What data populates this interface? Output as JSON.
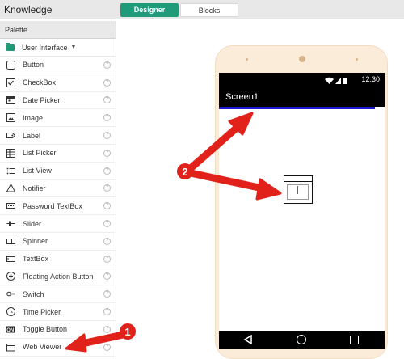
{
  "app": {
    "title": "Knowledge"
  },
  "tabs": [
    {
      "label": "Designer",
      "active": true
    },
    {
      "label": "Blocks",
      "active": false
    }
  ],
  "palette": {
    "header": "Palette",
    "category": "User Interface",
    "items": [
      {
        "label": "Button",
        "icon": "button-icon"
      },
      {
        "label": "CheckBox",
        "icon": "checkbox-icon"
      },
      {
        "label": "Date Picker",
        "icon": "calendar-icon"
      },
      {
        "label": "Image",
        "icon": "image-icon"
      },
      {
        "label": "Label",
        "icon": "label-icon"
      },
      {
        "label": "List Picker",
        "icon": "list-picker-icon"
      },
      {
        "label": "List View",
        "icon": "list-view-icon"
      },
      {
        "label": "Notifier",
        "icon": "warning-icon"
      },
      {
        "label": "Password TextBox",
        "icon": "password-icon"
      },
      {
        "label": "Slider",
        "icon": "slider-icon"
      },
      {
        "label": "Spinner",
        "icon": "spinner-icon"
      },
      {
        "label": "TextBox",
        "icon": "textbox-icon"
      },
      {
        "label": "Floating Action Button",
        "icon": "fab-icon"
      },
      {
        "label": "Switch",
        "icon": "switch-icon"
      },
      {
        "label": "Time Picker",
        "icon": "clock-icon"
      },
      {
        "label": "Toggle Button",
        "icon": "toggle-on-icon"
      },
      {
        "label": "Web Viewer",
        "icon": "web-viewer-icon"
      }
    ],
    "help_glyph": "?"
  },
  "phone": {
    "time": "12:30",
    "screen_title": "Screen1",
    "title_bar_color": "#000000",
    "accent_line_color": "#1a1ad8"
  },
  "annotations": [
    {
      "number": "1",
      "color": "#e0221b"
    },
    {
      "number": "2",
      "color": "#e0221b"
    }
  ],
  "colors": {
    "designer_tab": "#1f9b7a",
    "phone_frame": "#fbecd9"
  }
}
